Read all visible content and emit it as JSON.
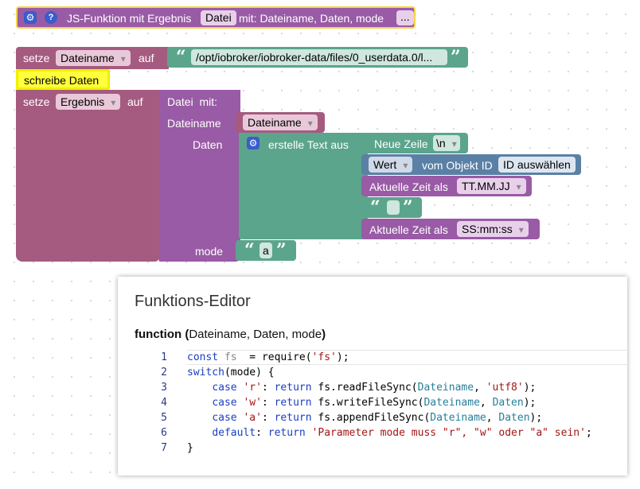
{
  "colors": {
    "procedure": "#995ba5",
    "variable": "#a55b80",
    "text": "#5ba58c",
    "object": "#5b80a5",
    "highlight": "#ffff00"
  },
  "header": {
    "gear_icon": "gear-icon",
    "help_icon": "help-icon",
    "title": "JS-Funktion mit Ergebnis",
    "func_name": "Datei",
    "params_label": "mit: Dateiname, Daten, mode",
    "more_label": "..."
  },
  "set1": {
    "setze": "setze",
    "var": "Dateiname",
    "auf": "auf",
    "value": "/opt/iobroker/iobroker-data/files/0_userdata.0/l..."
  },
  "comment": "schreibe Daten",
  "set2": {
    "setze": "setze",
    "var": "Ergebnis",
    "auf": "auf"
  },
  "call": {
    "title": "Datei  mit:",
    "param1_label": "Dateiname",
    "param1_var": "Dateiname",
    "param2_label": "Daten",
    "param3_label": "mode",
    "mode_value": "a"
  },
  "text_join": {
    "label": "erstelle Text aus",
    "newline_label": "Neue Zeile",
    "newline_value": "\\n",
    "wert_label": "Wert",
    "vom_objekt": "vom Objekt ID",
    "id_select": "ID auswählen",
    "zeit1_label": "Aktuelle Zeit als",
    "zeit1_format": "TT.MM.JJ",
    "empty_text": "",
    "zeit2_label": "Aktuelle Zeit als",
    "zeit2_format": "SS:mm:ss"
  },
  "editor": {
    "title": "Funktions-Editor",
    "sig_keyword": "function",
    "sig_params": "Dateiname, Daten, mode",
    "lines": [
      {
        "no": "1",
        "t": [
          [
            "kw",
            "const "
          ],
          [
            "vr",
            "fs"
          ],
          [
            "",
            "  = "
          ],
          [
            "",
            "require("
          ],
          [
            "st",
            "'fs'"
          ],
          [
            "",
            ");"
          ]
        ]
      },
      {
        "no": "2",
        "t": [
          [
            "kw",
            "switch"
          ],
          [
            "",
            "(mode) {"
          ]
        ]
      },
      {
        "no": "3",
        "t": [
          [
            "",
            "    "
          ],
          [
            "kw",
            "case "
          ],
          [
            "st",
            "'r'"
          ],
          [
            "",
            ": "
          ],
          [
            "kw",
            "return "
          ],
          [
            "",
            "fs.readFileSync("
          ],
          [
            "pm",
            "Dateiname"
          ],
          [
            "",
            ", "
          ],
          [
            "st",
            "'utf8'"
          ],
          [
            "",
            ");"
          ]
        ]
      },
      {
        "no": "4",
        "t": [
          [
            "",
            "    "
          ],
          [
            "kw",
            "case "
          ],
          [
            "st",
            "'w'"
          ],
          [
            "",
            ": "
          ],
          [
            "kw",
            "return "
          ],
          [
            "",
            "fs.writeFileSync("
          ],
          [
            "pm",
            "Dateiname"
          ],
          [
            "",
            ", "
          ],
          [
            "pm",
            "Daten"
          ],
          [
            "",
            ");"
          ]
        ]
      },
      {
        "no": "5",
        "t": [
          [
            "",
            "    "
          ],
          [
            "kw",
            "case "
          ],
          [
            "st",
            "'a'"
          ],
          [
            "",
            ": "
          ],
          [
            "kw",
            "return "
          ],
          [
            "",
            "fs.appendFileSync("
          ],
          [
            "pm",
            "Dateiname"
          ],
          [
            "",
            ", "
          ],
          [
            "pm",
            "Daten"
          ],
          [
            "",
            ");"
          ]
        ]
      },
      {
        "no": "6",
        "t": [
          [
            "",
            "    "
          ],
          [
            "kw",
            "default"
          ],
          [
            "",
            ": "
          ],
          [
            "kw",
            "return "
          ],
          [
            "st",
            "'Parameter mode muss \"r\", \"w\" oder \"a\" sein'"
          ],
          [
            "",
            ";"
          ]
        ]
      },
      {
        "no": "7",
        "t": [
          [
            "",
            "}"
          ]
        ]
      }
    ]
  }
}
